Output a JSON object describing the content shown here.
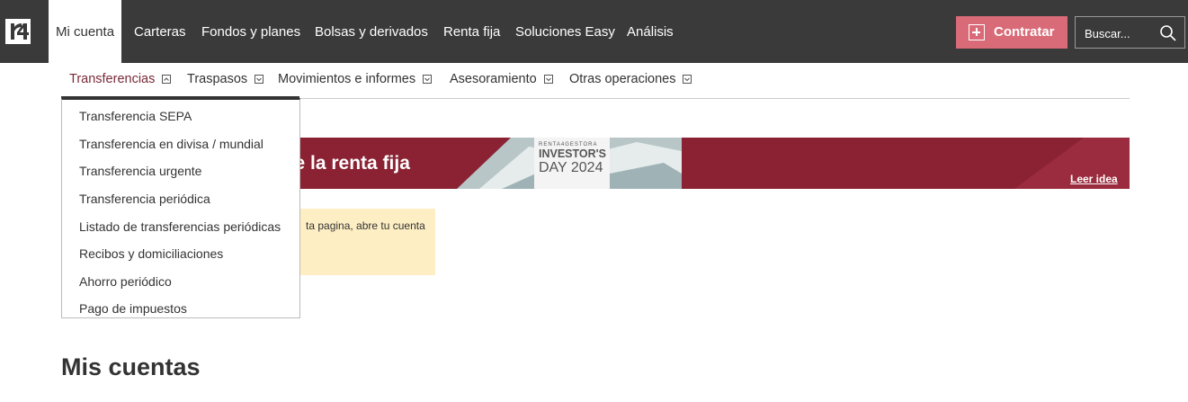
{
  "topnav": {
    "logo_text": "r4",
    "items": [
      {
        "label": "Mi cuenta"
      },
      {
        "label": "Carteras"
      },
      {
        "label": "Fondos y planes"
      },
      {
        "label": "Bolsas y derivados"
      },
      {
        "label": "Renta fija"
      },
      {
        "label": "Soluciones Easy"
      },
      {
        "label": "Análisis"
      }
    ],
    "contratar_label": "Contratar",
    "search_placeholder": "Buscar..."
  },
  "subnav": {
    "items": [
      {
        "label": "Transferencias"
      },
      {
        "label": "Traspasos"
      },
      {
        "label": "Movimientos e informes"
      },
      {
        "label": "Asesoramiento"
      },
      {
        "label": "Otras operaciones"
      }
    ]
  },
  "dropdown": {
    "items": [
      {
        "label": "Transferencia SEPA"
      },
      {
        "label": "Transferencia en divisa / mundial"
      },
      {
        "label": "Transferencia urgente"
      },
      {
        "label": "Transferencia periódica"
      },
      {
        "label": "Listado de transferencias periódicas"
      },
      {
        "label": "Recibos y domiciliaciones"
      },
      {
        "label": "Ahorro periódico"
      },
      {
        "label": "Pago de impuestos"
      }
    ]
  },
  "banner": {
    "title_partial": "o de la renta fija",
    "event_small": "RENTA4GESTORA",
    "event_line1": "INVESTOR'S",
    "event_line2": "DAY 2024",
    "link": "Leer idea",
    "color": "#8a2233"
  },
  "notice": {
    "text_partial": "ta pagina, abre tu cuenta"
  },
  "main": {
    "heading": "Mis cuentas"
  },
  "colors": {
    "topbar": "#3a3a3a",
    "accent": "#d96b78",
    "active_sub": "#7a2a38",
    "notice_bg": "#fdeec3"
  }
}
